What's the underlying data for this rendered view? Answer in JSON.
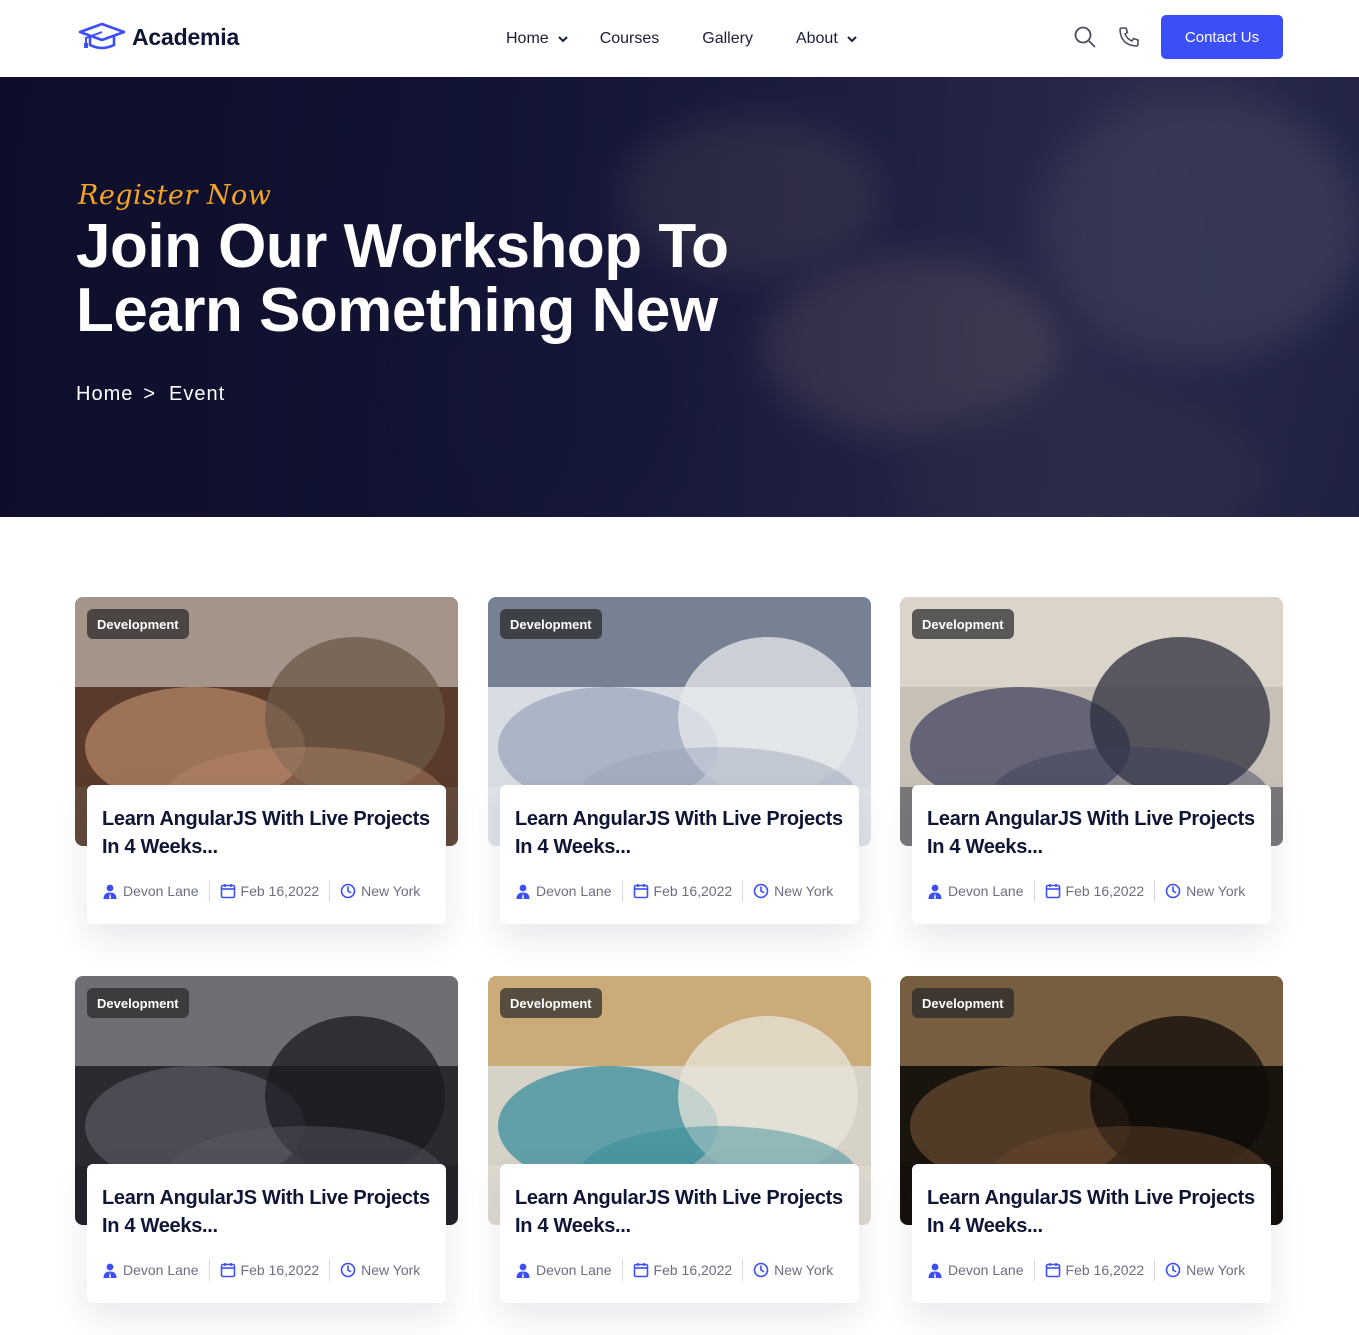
{
  "brand": {
    "name": "Academia",
    "accent": "#3b4ef8",
    "tag_color": "#f5a524"
  },
  "nav": {
    "items": [
      {
        "label": "Home",
        "has_dropdown": true
      },
      {
        "label": "Courses",
        "has_dropdown": false
      },
      {
        "label": "Gallery",
        "has_dropdown": false
      },
      {
        "label": "About",
        "has_dropdown": true
      }
    ],
    "icons": [
      "search-icon",
      "phone-icon"
    ],
    "cta": "Contact Us"
  },
  "hero": {
    "tag": "Register Now",
    "title": "Join Our Workshop To Learn Something New",
    "breadcrumb": [
      "Home",
      "Event"
    ]
  },
  "events": [
    {
      "category": "Development",
      "title": "Learn AngularJS With Live Projects In 4 Weeks...",
      "author": "Devon Lane",
      "date": "Feb 16,2022",
      "location": "New York"
    },
    {
      "category": "Development",
      "title": "Learn AngularJS With Live Projects In 4 Weeks...",
      "author": "Devon Lane",
      "date": "Feb 16,2022",
      "location": "New York"
    },
    {
      "category": "Development",
      "title": "Learn AngularJS With Live Projects In 4 Weeks...",
      "author": "Devon Lane",
      "date": "Feb 16,2022",
      "location": "New York"
    },
    {
      "category": "Development",
      "title": "Learn AngularJS With Live Projects In 4 Weeks...",
      "author": "Devon Lane",
      "date": "Feb 16,2022",
      "location": "New York"
    },
    {
      "category": "Development",
      "title": "Learn AngularJS With Live Projects In 4 Weeks...",
      "author": "Devon Lane",
      "date": "Feb 16,2022",
      "location": "New York"
    },
    {
      "category": "Development",
      "title": "Learn AngularJS With Live Projects In 4 Weeks...",
      "author": "Devon Lane",
      "date": "Feb 16,2022",
      "location": "New York"
    }
  ]
}
